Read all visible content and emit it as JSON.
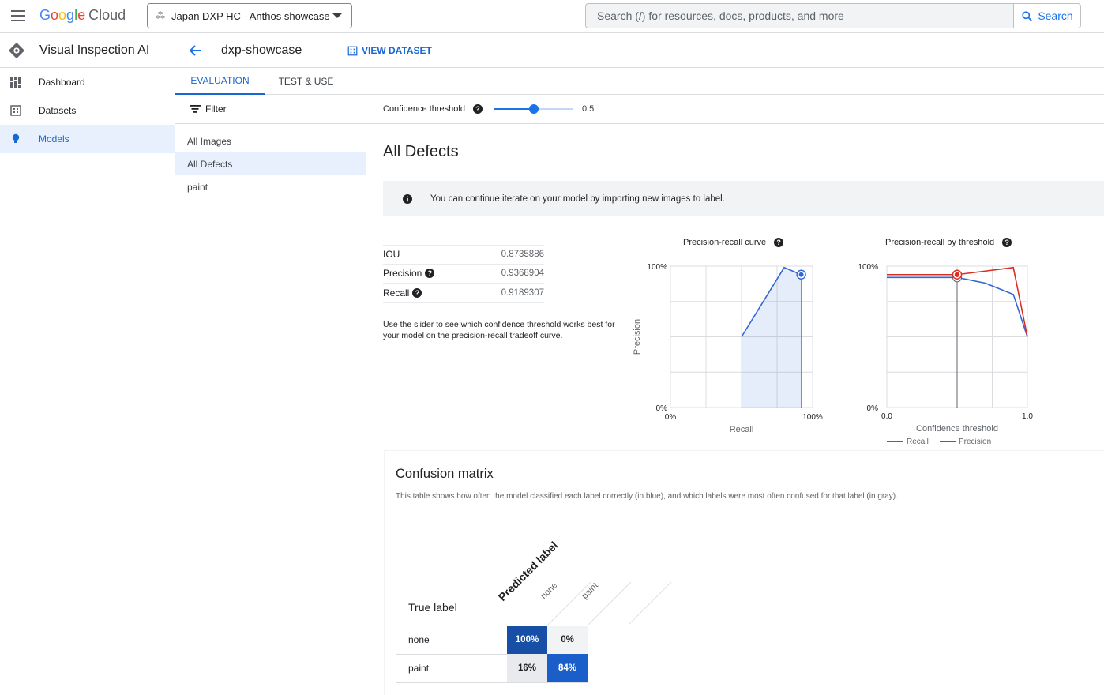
{
  "topbar": {
    "logo_google": "Google",
    "logo_cloud": "Cloud",
    "project_name": "Japan DXP HC - Anthos showcase",
    "search_placeholder": "Search (/) for resources, docs, products, and more",
    "search_button": "Search"
  },
  "sidebar": {
    "product_title": "Visual Inspection AI",
    "items": [
      {
        "label": "Dashboard",
        "icon": "dashboard-icon"
      },
      {
        "label": "Datasets",
        "icon": "dataset-icon"
      },
      {
        "label": "Models",
        "icon": "lightbulb-icon",
        "active": true
      }
    ]
  },
  "header": {
    "dataset_name": "dxp-showcase",
    "view_dataset": "VIEW DATASET"
  },
  "tabs": [
    {
      "label": "EVALUATION",
      "active": true
    },
    {
      "label": "TEST & USE"
    }
  ],
  "filter": {
    "label": "Filter",
    "items": [
      "All Images",
      "All Defects",
      "paint"
    ],
    "active": "All Defects"
  },
  "confidence": {
    "label": "Confidence threshold",
    "value": "0.5",
    "fraction": 0.5
  },
  "section_title": "All Defects",
  "banner_text": "You can continue iterate on your model by importing new images to label.",
  "metrics": [
    {
      "label": "IOU",
      "value": "0.8735886",
      "help": false
    },
    {
      "label": "Precision",
      "value": "0.9368904",
      "help": true
    },
    {
      "label": "Recall",
      "value": "0.9189307",
      "help": true
    }
  ],
  "metrics_note": "Use the slider to see which confidence threshold works best for your model on the precision-recall tradeoff curve.",
  "chart_data": [
    {
      "type": "area",
      "title": "Precision-recall curve",
      "xlabel": "Recall",
      "ylabel": "Precision",
      "x_ticks": [
        "0%",
        "100%"
      ],
      "y_ticks": [
        "0%",
        "100%"
      ],
      "xlim": [
        0,
        1
      ],
      "ylim": [
        0,
        1
      ],
      "x": [
        0.5,
        0.8,
        0.92
      ],
      "y": [
        0.5,
        0.99,
        0.94
      ],
      "highlight": {
        "x": 0.92,
        "y": 0.94
      },
      "color": "#3367d6",
      "grid": true
    },
    {
      "type": "line",
      "title": "Precision-recall by threshold",
      "xlabel": "Confidence threshold",
      "x_ticks": [
        "0.0",
        "1.0"
      ],
      "y_ticks": [
        "0%",
        "100%"
      ],
      "xlim": [
        0,
        1
      ],
      "ylim": [
        0,
        1
      ],
      "threshold": 0.5,
      "series": [
        {
          "name": "Recall",
          "color": "#3367d6",
          "x": [
            0,
            0.5,
            0.7,
            0.9,
            1.0
          ],
          "y": [
            0.92,
            0.92,
            0.88,
            0.8,
            0.5
          ]
        },
        {
          "name": "Precision",
          "color": "#d93025",
          "x": [
            0,
            0.5,
            0.9,
            1.0
          ],
          "y": [
            0.94,
            0.94,
            0.99,
            0.5
          ]
        }
      ],
      "legend": "bottom",
      "grid": true
    }
  ],
  "confusion": {
    "title": "Confusion matrix",
    "description": "This table shows how often the model classified each label correctly (in blue), and which labels were most often confused for that label (in gray).",
    "true_label": "True label",
    "predicted_label": "Predicted label",
    "columns": [
      "none",
      "paint"
    ],
    "rows": [
      {
        "label": "none",
        "cells": [
          "100%",
          "0%"
        ],
        "colors": [
          "#174ea6",
          "#f1f3f4"
        ]
      },
      {
        "label": "paint",
        "cells": [
          "16%",
          "84%"
        ],
        "colors": [
          "#e8eaed",
          "#1a5fc9"
        ]
      }
    ]
  }
}
